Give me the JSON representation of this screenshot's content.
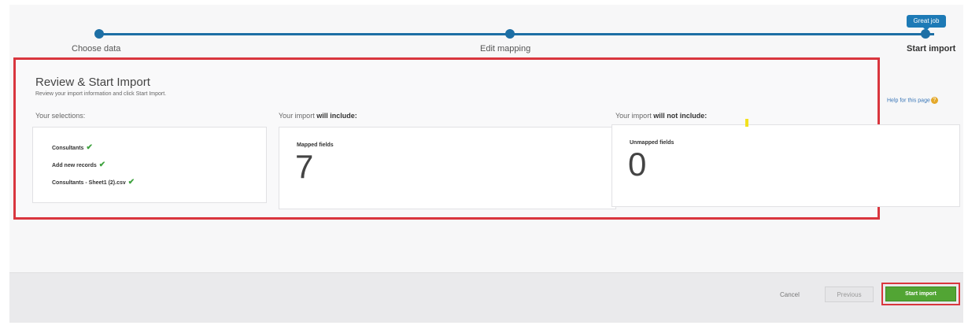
{
  "stepper": {
    "badge": "Great job",
    "steps": [
      {
        "label": "Choose data"
      },
      {
        "label": "Edit mapping"
      },
      {
        "label": "Start import"
      }
    ]
  },
  "review": {
    "title": "Review & Start Import",
    "subtitle": "Review your import information and click Start Import.",
    "help_link": "Help for this page",
    "selections_header": "Your selections:",
    "include_header_prefix": "Your import ",
    "include_header_bold": "will include:",
    "exclude_header_prefix": "Your import ",
    "exclude_header_bold": "will not include:",
    "selections": [
      {
        "label": "Consultants"
      },
      {
        "label": "Add new records"
      },
      {
        "label": "Consultants - Sheet1 (2).csv"
      }
    ],
    "mapped": {
      "label": "Mapped fields",
      "count": "7"
    },
    "unmapped": {
      "label": "Unmapped fields",
      "count": "0"
    }
  },
  "footer": {
    "cancel_label": "Cancel",
    "previous_label": "Previous",
    "start_label": "Start import"
  },
  "colors": {
    "primary": "#1d6fa5",
    "success": "#52a534",
    "highlight": "#d9363e"
  }
}
